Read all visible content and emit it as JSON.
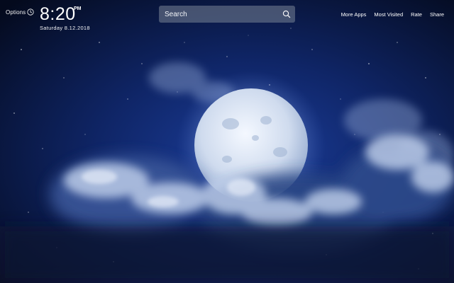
{
  "options_label": "Options",
  "clock": {
    "time": "8:20",
    "period": "PM",
    "date": "Saturday  8.12.2018"
  },
  "search": {
    "placeholder": "Search"
  },
  "nav": [
    {
      "label": "More Apps"
    },
    {
      "label": "Most Visited"
    },
    {
      "label": "Rate"
    },
    {
      "label": "Share"
    }
  ],
  "icons": {
    "clock": "clock-icon",
    "search": "search-icon"
  },
  "colors": {
    "sky_dark": "#050d24",
    "sky_mid": "#12286b",
    "moon": "#dfe9f7",
    "cloud": "#c7d6ee"
  }
}
